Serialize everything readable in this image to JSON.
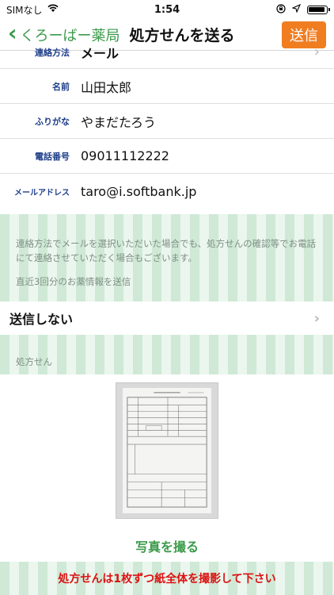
{
  "status_bar": {
    "carrier": "SIMなし",
    "time": "1:54"
  },
  "nav": {
    "back_label": "くろーばー薬局",
    "title": "処方せんを送る",
    "send_label": "送信"
  },
  "form": {
    "rows": [
      {
        "label": "連絡方法",
        "value": "メール"
      },
      {
        "label": "名前",
        "value": "山田太郎"
      },
      {
        "label": "ふりがな",
        "value": "やまだたろう"
      },
      {
        "label": "電話番号",
        "value": "09011112222"
      },
      {
        "label": "メールアドレス",
        "value": "taro@i.softbank.jp"
      }
    ]
  },
  "note": {
    "text": "連絡方法でメールを選択いただいた場合でも、処方せんの確認等でお電話にて連絡させていただく場合もございます。",
    "history_label": "直近3回分のお薬情報を送信"
  },
  "history_option": {
    "value": "送信しない"
  },
  "prescription": {
    "section_label": "処方せん",
    "photo_button": "写真を撮る",
    "warning": "処方せんは1枚ずつ紙全体を撮影して下さい"
  },
  "colors": {
    "accent_green": "#3b9a4a",
    "send_orange": "#f07d20",
    "warning_red": "#dd1111"
  }
}
